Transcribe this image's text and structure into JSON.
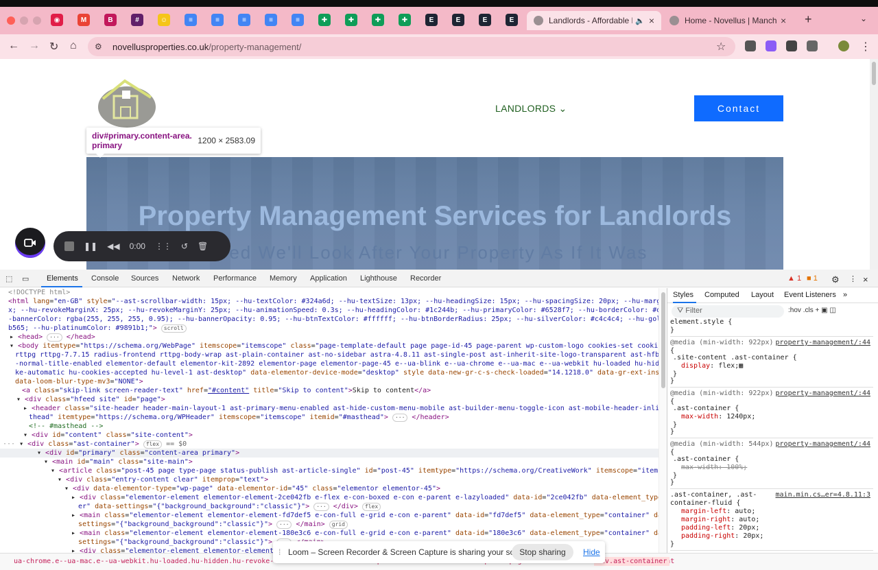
{
  "browser": {
    "pinned_tabs": [
      {
        "icon": "record-icon",
        "color": "#e11d48"
      },
      {
        "icon": "gmail-icon",
        "color": "#ea4335"
      },
      {
        "icon": "b-icon",
        "color": "#c2185b"
      },
      {
        "icon": "slack-icon",
        "color": "#611f69"
      },
      {
        "icon": "smiley-icon",
        "color": "#f5c518"
      },
      {
        "icon": "docs-icon",
        "color": "#4285f4"
      },
      {
        "icon": "docs-icon",
        "color": "#4285f4"
      },
      {
        "icon": "docs-icon",
        "color": "#4285f4"
      },
      {
        "icon": "docs-icon",
        "color": "#4285f4"
      },
      {
        "icon": "docs-icon",
        "color": "#4285f4"
      },
      {
        "icon": "sheets-icon",
        "color": "#0f9d58"
      },
      {
        "icon": "sheets-icon",
        "color": "#0f9d58"
      },
      {
        "icon": "sheets-icon",
        "color": "#0f9d58"
      },
      {
        "icon": "sheets-icon",
        "color": "#0f9d58"
      },
      {
        "icon": "elementor-icon",
        "color": "#1e2433"
      },
      {
        "icon": "elementor-icon",
        "color": "#1e2433"
      },
      {
        "icon": "elementor-icon",
        "color": "#1e2433"
      },
      {
        "icon": "elementor-icon",
        "color": "#1e2433"
      }
    ],
    "tabs": [
      {
        "title": "Landlords - Affordable Pro"
      },
      {
        "title": "Home - Novellus | Manchest"
      }
    ],
    "url_host": "novellusproperties.co.uk",
    "url_path": "/property-management/"
  },
  "page": {
    "nav_landlords": "LANDLORDS",
    "contact_label": "Contact",
    "hero_title": "Property Management Services for Landlords",
    "hero_sub": "red We'll Look After Your Property As If It Was",
    "tooltip_selector": "div#primary.content-area.",
    "tooltip_selector2": "primary",
    "tooltip_dims": "1200 × 2583.09"
  },
  "loom": {
    "time": "0:00",
    "share_text": "Loom – Screen Recorder & Screen Capture is sharing your screen.",
    "stop_label": "Stop sharing",
    "hide_label": "Hide"
  },
  "devtools": {
    "tabs": [
      "Elements",
      "Console",
      "Sources",
      "Network",
      "Performance",
      "Memory",
      "Application",
      "Lighthouse",
      "Recorder"
    ],
    "errors": "1",
    "warnings": "1",
    "side_tabs": [
      "Styles",
      "Computed",
      "Layout",
      "Event Listeners"
    ],
    "filter_placeholder": "Filter",
    "hov": ":hov",
    "cls": ".cls",
    "breadcrumb": "ua-chrome.e--ua-mac.e--ua-webkit.hu-loaded.hu-hidden.hu-revoke-automatic hu-cookies-accepted.hu-level-1.ast-desktop   div.page.hfeed.site   div.content.site-content",
    "breadcrumb_tail": "div.ast-container"
  }
}
